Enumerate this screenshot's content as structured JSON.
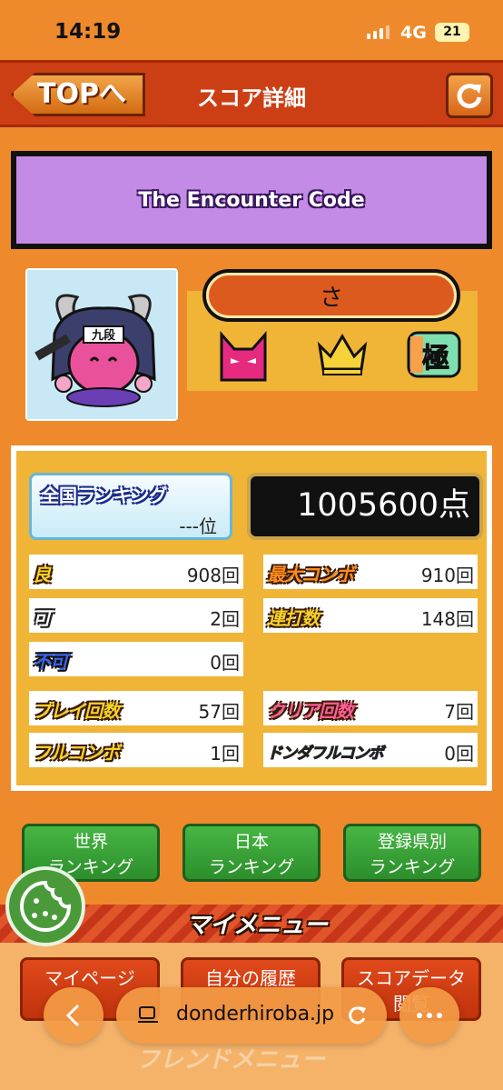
{
  "status": {
    "time": "14:19",
    "network": "4G",
    "battery": "21"
  },
  "header": {
    "back_label": "TOPへ",
    "title": "スコア詳細"
  },
  "song": {
    "title": "The Encounter Code"
  },
  "player": {
    "name": "さ",
    "avatar_badge": "九段",
    "extreme_badge": "極"
  },
  "ranking": {
    "label": "全国ランキング",
    "value": "---位"
  },
  "score": {
    "value": "1005600点"
  },
  "stats": {
    "good_label": "良",
    "good_value": "908回",
    "ok_label": "可",
    "ok_value": "2回",
    "bad_label": "不可",
    "bad_value": "0回",
    "maxcombo_label": "最大コンボ",
    "maxcombo_value": "910回",
    "drumroll_label": "連打数",
    "drumroll_value": "148回",
    "play_label": "プレイ回数",
    "play_value": "57回",
    "clear_label": "クリア回数",
    "clear_value": "7回",
    "fullcombo_label": "フルコンボ",
    "fullcombo_value": "1回",
    "dondaful_label": "ドンダフルコンボ",
    "dondaful_value": "0回"
  },
  "rank_buttons": [
    {
      "line1": "世界",
      "line2": "ランキング"
    },
    {
      "line1": "日本",
      "line2": "ランキング"
    },
    {
      "line1": "登録県別",
      "line2": "ランキング"
    }
  ],
  "my_menu": {
    "title": "マイメニュー"
  },
  "menu_buttons": [
    {
      "line1": "マイページ",
      "line2": ""
    },
    {
      "line1": "自分の履歴",
      "line2": ""
    },
    {
      "line1": "スコアデータ",
      "line2": "閲覧"
    }
  ],
  "friend_menu": {
    "title": "フレンドメニュー"
  },
  "browser": {
    "url": "donderhiroba.jp"
  },
  "colors": {
    "background": "#ee8a2c",
    "header": "#cc3f14",
    "song_bar": "#c48be6",
    "green_button": "#3a9f38",
    "red_button": "#d23e12"
  }
}
